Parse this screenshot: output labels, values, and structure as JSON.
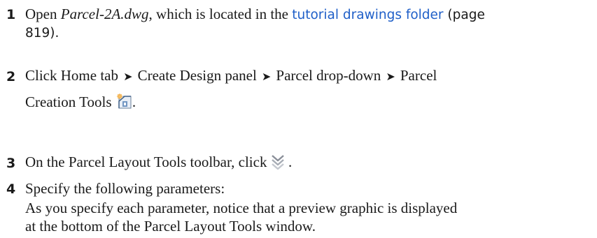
{
  "steps": [
    {
      "number": "1",
      "prefix": "Open ",
      "filename": "Parcel-2A.dwg",
      "middle": ", which is located in the ",
      "link": "tutorial drawings folder",
      "suffix_line1": " (page",
      "suffix_line2": "819)."
    },
    {
      "number": "2",
      "segments": [
        "Click Home tab",
        "Create Design panel",
        "Parcel drop-down",
        "Parcel"
      ],
      "arrow": "➤",
      "line2": "Creation Tools",
      "end": ".",
      "icon": "parcel-creation-tools-icon"
    },
    {
      "number": "3",
      "text": "On the Parcel Layout Tools toolbar, click",
      "end": " .",
      "icon": "expand-chevron-icon"
    },
    {
      "number": "4",
      "text": "Specify the following parameters:",
      "note_line1": "As you specify each parameter, notice that a preview graphic is displayed",
      "note_line2": "at the bottom of the Parcel Layout Tools window."
    }
  ],
  "colors": {
    "link": "#1f5fc8",
    "text": "#1a1a1a"
  }
}
